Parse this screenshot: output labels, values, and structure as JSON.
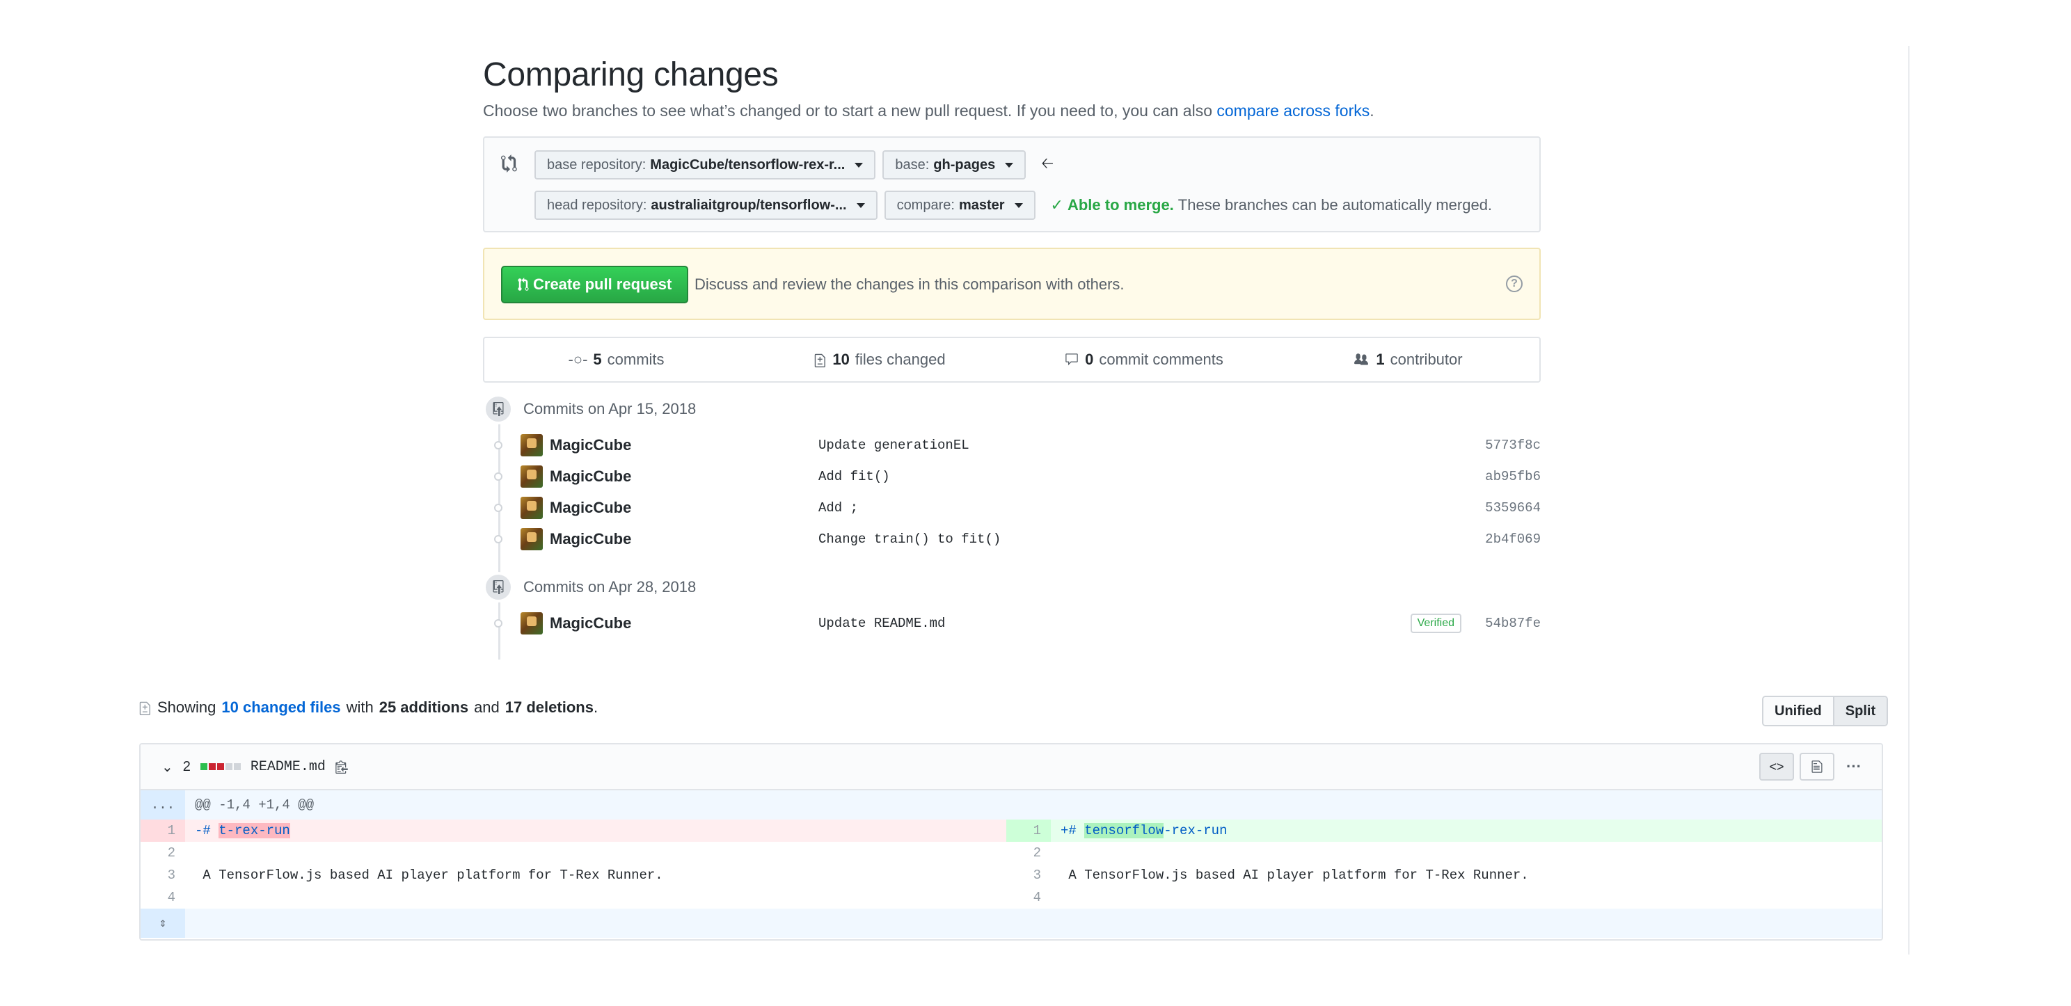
{
  "header": {
    "title": "Comparing changes",
    "subtitle": "Choose two branches to see what’s changed or to start a new pull request. If you need to, you can also",
    "subtitle_link": "compare across forks",
    "subtitle_end": "."
  },
  "range": {
    "base_repo_label": "base repository:",
    "base_repo_value": "MagicCube/tensorflow-rex-r...",
    "base_label": "base:",
    "base_value": "gh-pages",
    "head_repo_label": "head repository:",
    "head_repo_value": "australiaitgroup/tensorflow-...",
    "compare_label": "compare:",
    "compare_value": "master",
    "merge_ok": "Able to merge.",
    "merge_text": "These branches can be automatically merged."
  },
  "pr": {
    "button_label": "Create pull request",
    "text": "Discuss and review the changes in this comparison with others."
  },
  "summary": {
    "commits_count": "5",
    "commits_label": "commits",
    "files_count": "10",
    "files_label": "files changed",
    "comments_count": "0",
    "comments_label": "commit comments",
    "contributors_count": "1",
    "contributors_label": "contributor"
  },
  "commit_groups": [
    {
      "heading": "Commits on Apr 15, 2018",
      "commits": [
        {
          "author": "MagicCube",
          "message": "Update generationEL",
          "sha": "5773f8c"
        },
        {
          "author": "MagicCube",
          "message": "Add fit()",
          "sha": "ab95fb6"
        },
        {
          "author": "MagicCube",
          "message": "Add ;",
          "sha": "5359664"
        },
        {
          "author": "MagicCube",
          "message": "Change train() to fit()",
          "sha": "2b4f069"
        }
      ]
    },
    {
      "heading": "Commits on Apr 28, 2018",
      "commits": [
        {
          "author": "MagicCube",
          "message": "Update README.md",
          "sha": "54b87fe",
          "badge": "Verified"
        }
      ]
    }
  ],
  "files_summary": {
    "showing": "Showing",
    "changed_files": "10 changed files",
    "with": "with",
    "additions": "25 additions",
    "and": "and",
    "deletions": "17 deletions",
    "end": "."
  },
  "view_toggle": {
    "unified": "Unified",
    "split": "Split"
  },
  "file": {
    "changes": "2",
    "name": "README.md",
    "hunk_expand": "...",
    "hunk_header": "@@ -1,4 +1,4 @@",
    "left_lines": [
      {
        "num": "1",
        "prefix": "-# ",
        "word": "t-rex-run",
        "rest": ""
      },
      {
        "num": "2",
        "text": ""
      },
      {
        "num": "3",
        "text": " A TensorFlow.js based AI player platform for T-Rex Runner."
      },
      {
        "num": "4",
        "text": ""
      }
    ],
    "right_lines": [
      {
        "num": "1",
        "prefix": "+# ",
        "word": "tensorflow",
        "rest": "-rex-run"
      },
      {
        "num": "2",
        "text": ""
      },
      {
        "num": "3",
        "text": " A TensorFlow.js based AI player platform for T-Rex Runner."
      },
      {
        "num": "4",
        "text": ""
      }
    ]
  },
  "colors": {
    "link": "#0366d6",
    "success": "#28a745",
    "deletion_bg": "#ffeef0",
    "addition_bg": "#e6ffed"
  }
}
